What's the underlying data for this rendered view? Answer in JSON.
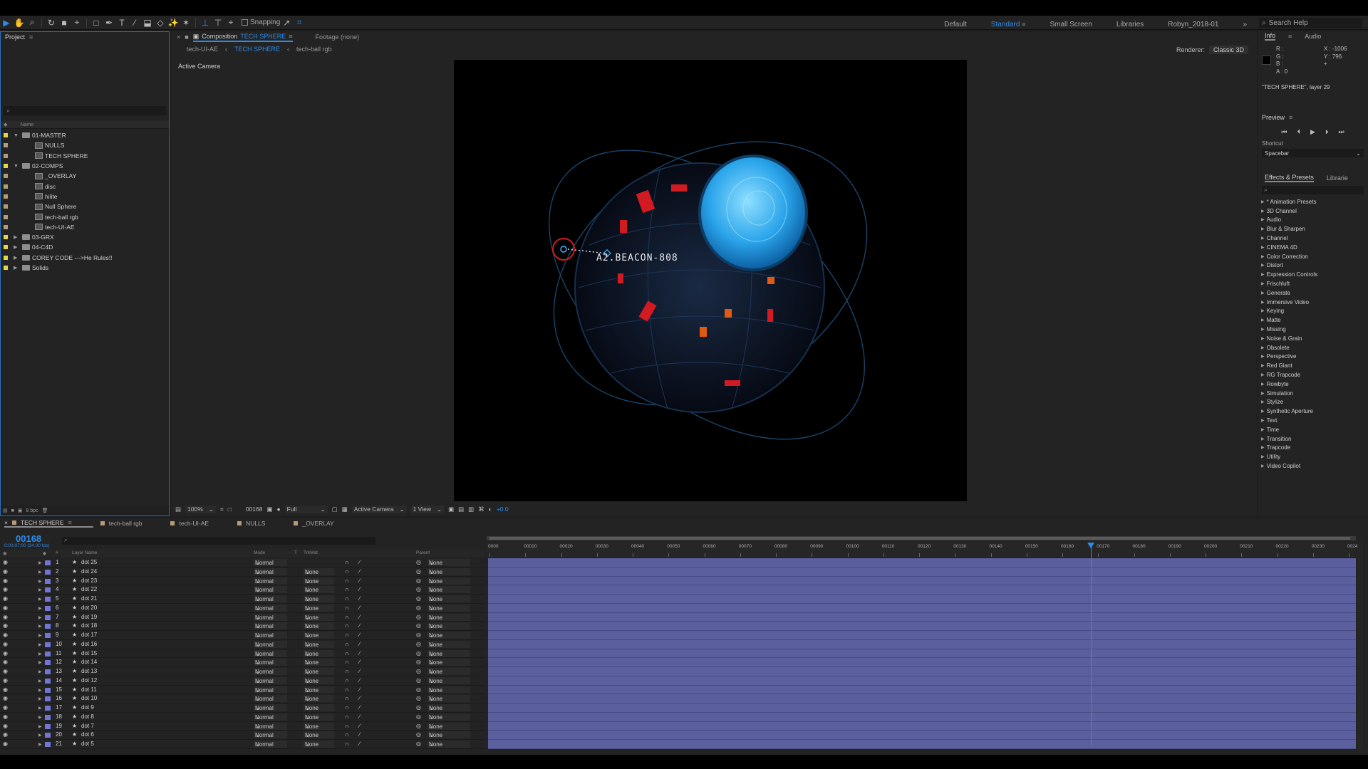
{
  "toolbar": {
    "snapping_label": "Snapping",
    "workspaces": [
      "Default",
      "Standard",
      "Small Screen",
      "Libraries",
      "Robyn_2018-01"
    ],
    "active_workspace": "Standard",
    "search_placeholder": "Search Help"
  },
  "project": {
    "title": "Project",
    "column_name": "Name",
    "bpc": "8 bpc",
    "items": [
      {
        "label": "01-MASTER",
        "type": "folder",
        "depth": 0,
        "expanded": true,
        "color": "#e3d54a"
      },
      {
        "label": "NULLS",
        "type": "comp",
        "depth": 1,
        "color": "#b59b76"
      },
      {
        "label": "TECH SPHERE",
        "type": "comp",
        "depth": 1,
        "color": "#b59b76"
      },
      {
        "label": "02-COMPS",
        "type": "folder",
        "depth": 0,
        "expanded": true,
        "color": "#e3d54a"
      },
      {
        "label": "_OVERLAY",
        "type": "comp",
        "depth": 1,
        "color": "#b59b76"
      },
      {
        "label": "disc",
        "type": "comp",
        "depth": 1,
        "color": "#b59b76"
      },
      {
        "label": "hilite",
        "type": "comp",
        "depth": 1,
        "color": "#b59b76"
      },
      {
        "label": "Null Sphere",
        "type": "comp",
        "depth": 1,
        "color": "#b59b76"
      },
      {
        "label": "tech-ball rgb",
        "type": "comp",
        "depth": 1,
        "color": "#b59b76"
      },
      {
        "label": "tech-UI-AE",
        "type": "comp",
        "depth": 1,
        "color": "#b59b76"
      },
      {
        "label": "03-GRX",
        "type": "folder",
        "depth": 0,
        "expanded": false,
        "color": "#e3d54a"
      },
      {
        "label": "04-C4D",
        "type": "folder",
        "depth": 0,
        "expanded": false,
        "color": "#e3d54a"
      },
      {
        "label": "COREY CODE --->He Rules!!",
        "type": "folder",
        "depth": 0,
        "expanded": false,
        "color": "#e3d54a"
      },
      {
        "label": "Solids",
        "type": "folder",
        "depth": 0,
        "expanded": false,
        "color": "#e3d54a"
      }
    ]
  },
  "composition": {
    "tab_prefix": "Composition",
    "tab_name": "TECH SPHERE",
    "footage_tab": "Footage (none)",
    "flow": [
      "tech-UI-AE",
      "TECH SPHERE",
      "tech-ball rgb"
    ],
    "renderer_label": "Renderer:",
    "renderer_value": "Classic 3D",
    "active_camera_label": "Active Camera",
    "beacon_text": "A2.BEACON-808",
    "view_bar": {
      "zoom": "100%",
      "frame": "00168",
      "resolution": "Full",
      "camera": "Active Camera",
      "views": "1 View",
      "exposure": "+0.0"
    }
  },
  "info_panel": {
    "tabs": [
      "Info",
      "Audio"
    ],
    "r": "R :",
    "g": "G :",
    "b": "B :",
    "a": "A : 0",
    "x": "X : -1006",
    "y": "Y : 796",
    "layer_info": "\"TECH SPHERE\", layer 29"
  },
  "preview_panel": {
    "title": "Preview",
    "shortcut_label": "Shortcut",
    "shortcut_value": "Spacebar"
  },
  "effects_panel": {
    "tabs": [
      "Effects & Presets",
      "Librarie"
    ],
    "categories": [
      "* Animation Presets",
      "3D Channel",
      "Audio",
      "Blur & Sharpen",
      "Channel",
      "CINEMA 4D",
      "Color Correction",
      "Distort",
      "Expression Controls",
      "Frischluft",
      "Generate",
      "Immersive Video",
      "Keying",
      "Matte",
      "Missing",
      "Noise & Grain",
      "Obsolete",
      "Perspective",
      "Red Giant",
      "RG Trapcode",
      "Rowbyte",
      "Simulation",
      "Stylize",
      "Synthetic Aperture",
      "Text",
      "Time",
      "Transition",
      "Trapcode",
      "Utility",
      "Video Copilot"
    ]
  },
  "timeline": {
    "tabs": [
      {
        "label": "TECH SPHERE",
        "color": "#b59b76",
        "active": true
      },
      {
        "label": "tech-ball rgb",
        "color": "#b59b76",
        "active": false
      },
      {
        "label": "tech-UI-AE",
        "color": "#b59b76",
        "active": false
      },
      {
        "label": "NULLS",
        "color": "#b59b76",
        "active": false
      },
      {
        "label": "_OVERLAY",
        "color": "#b59b76",
        "active": false
      }
    ],
    "timecode": "00168",
    "fps": "0:00:07:00 (24.00 fps)",
    "columns": {
      "hash": "#",
      "layer_name": "Layer Name",
      "mode": "Mode",
      "t": "T",
      "trkmat": "TrkMat",
      "parent": "Parent"
    },
    "ruler_labels": [
      "0000",
      "00010",
      "00020",
      "00030",
      "00040",
      "00050",
      "00060",
      "00070",
      "00080",
      "00090",
      "00100",
      "00110",
      "00120",
      "00130",
      "00140",
      "00150",
      "00160",
      "00170",
      "00180",
      "00190",
      "00200",
      "00210",
      "00220",
      "00230",
      "0024"
    ],
    "current_frame": 168,
    "total_frames": 240,
    "layers": [
      {
        "num": "1",
        "name": "dot 25",
        "mode": "Normal",
        "trkmat": "",
        "parent": "None"
      },
      {
        "num": "2",
        "name": "dot 24",
        "mode": "Normal",
        "trkmat": "None",
        "parent": "None"
      },
      {
        "num": "3",
        "name": "dot 23",
        "mode": "Normal",
        "trkmat": "None",
        "parent": "None"
      },
      {
        "num": "4",
        "name": "dot 22",
        "mode": "Normal",
        "trkmat": "None",
        "parent": "None"
      },
      {
        "num": "5",
        "name": "dot 21",
        "mode": "Normal",
        "trkmat": "None",
        "parent": "None"
      },
      {
        "num": "6",
        "name": "dot 20",
        "mode": "Normal",
        "trkmat": "None",
        "parent": "None"
      },
      {
        "num": "7",
        "name": "dot 19",
        "mode": "Normal",
        "trkmat": "None",
        "parent": "None"
      },
      {
        "num": "8",
        "name": "dot 18",
        "mode": "Normal",
        "trkmat": "None",
        "parent": "None"
      },
      {
        "num": "9",
        "name": "dot 17",
        "mode": "Normal",
        "trkmat": "None",
        "parent": "None"
      },
      {
        "num": "10",
        "name": "dot 16",
        "mode": "Normal",
        "trkmat": "None",
        "parent": "None"
      },
      {
        "num": "11",
        "name": "dot 15",
        "mode": "Normal",
        "trkmat": "None",
        "parent": "None"
      },
      {
        "num": "12",
        "name": "dot 14",
        "mode": "Normal",
        "trkmat": "None",
        "parent": "None"
      },
      {
        "num": "13",
        "name": "dot 13",
        "mode": "Normal",
        "trkmat": "None",
        "parent": "None"
      },
      {
        "num": "14",
        "name": "dot 12",
        "mode": "Normal",
        "trkmat": "None",
        "parent": "None"
      },
      {
        "num": "15",
        "name": "dot 11",
        "mode": "Normal",
        "trkmat": "None",
        "parent": "None"
      },
      {
        "num": "16",
        "name": "dot 10",
        "mode": "Normal",
        "trkmat": "None",
        "parent": "None"
      },
      {
        "num": "17",
        "name": "dot 9",
        "mode": "Normal",
        "trkmat": "None",
        "parent": "None"
      },
      {
        "num": "18",
        "name": "dot 8",
        "mode": "Normal",
        "trkmat": "None",
        "parent": "None"
      },
      {
        "num": "19",
        "name": "dot 7",
        "mode": "Normal",
        "trkmat": "None",
        "parent": "None"
      },
      {
        "num": "20",
        "name": "dot 6",
        "mode": "Normal",
        "trkmat": "None",
        "parent": "None"
      },
      {
        "num": "21",
        "name": "dot 5",
        "mode": "Normal",
        "trkmat": "None",
        "parent": "None"
      }
    ]
  },
  "colors": {
    "accent": "#2d8ceb",
    "layer_bar": "#5b5f9d",
    "layer_label": "#6f76d8",
    "folder_label": "#e3d54a",
    "comp_label": "#b59b76"
  }
}
